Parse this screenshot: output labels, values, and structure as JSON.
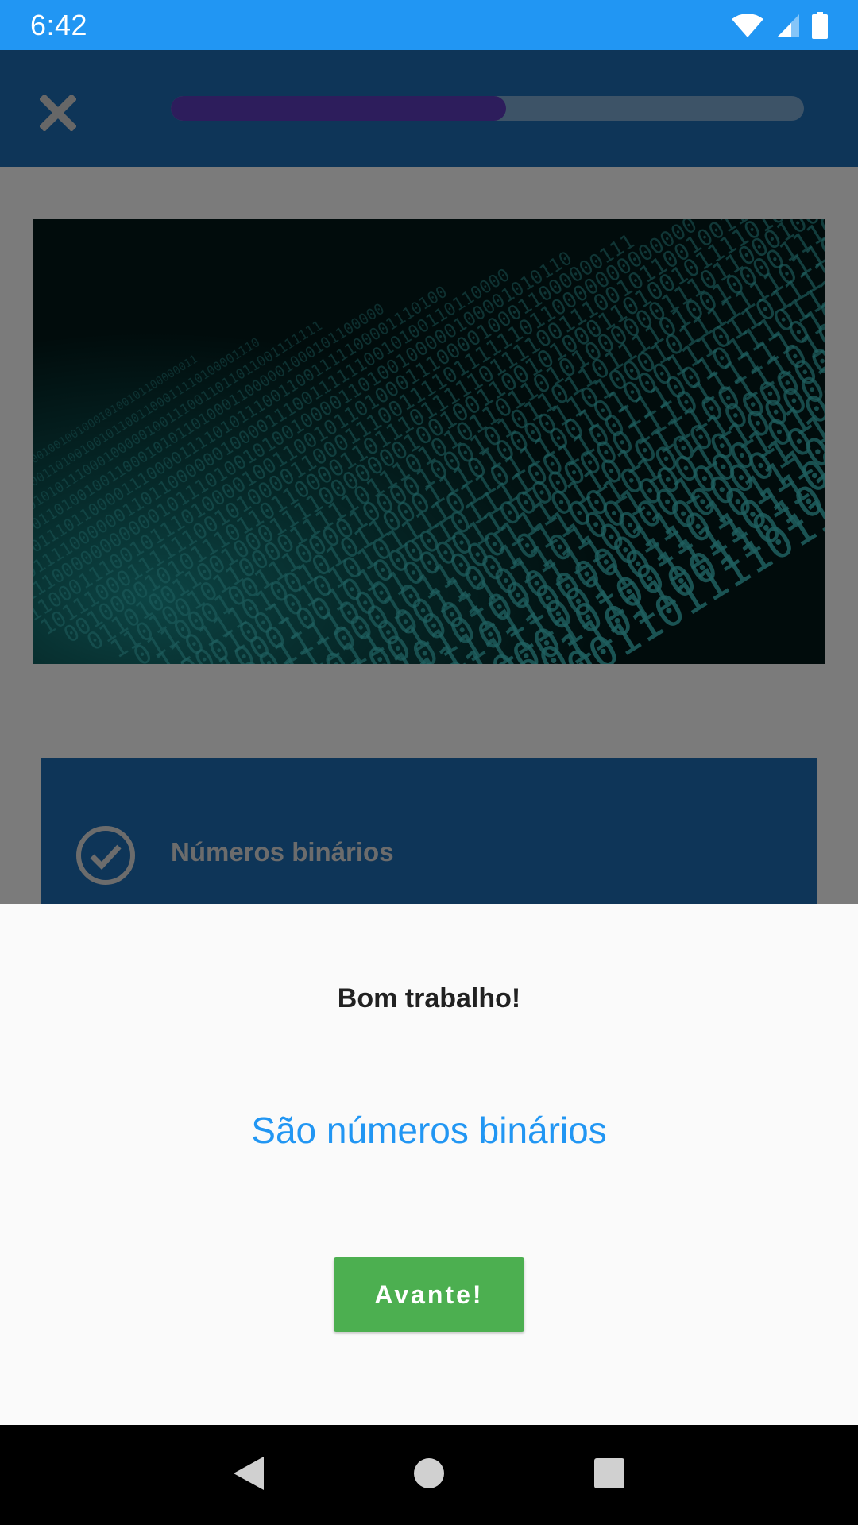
{
  "status_bar": {
    "time": "6:42",
    "icons": [
      "wifi-icon",
      "signal-icon",
      "battery-icon"
    ]
  },
  "app_bar": {
    "close_icon": "close-icon",
    "progress": 0.53,
    "colors": {
      "background": "#1C6AB1",
      "progress_fill": "#5b3ab8"
    }
  },
  "lesson": {
    "image_icon": "binary-numbers-image",
    "answer_option": {
      "label": "Números binários",
      "icon": "check-circle-icon"
    }
  },
  "feedback_sheet": {
    "title": "Bom trabalho!",
    "answer_text": "São números binários",
    "next_button": "Avante!",
    "colors": {
      "answer": "#2196F3",
      "button": "#4CAF50"
    }
  },
  "nav_bar": {
    "icons": [
      "back-icon",
      "home-icon",
      "recents-icon"
    ]
  }
}
